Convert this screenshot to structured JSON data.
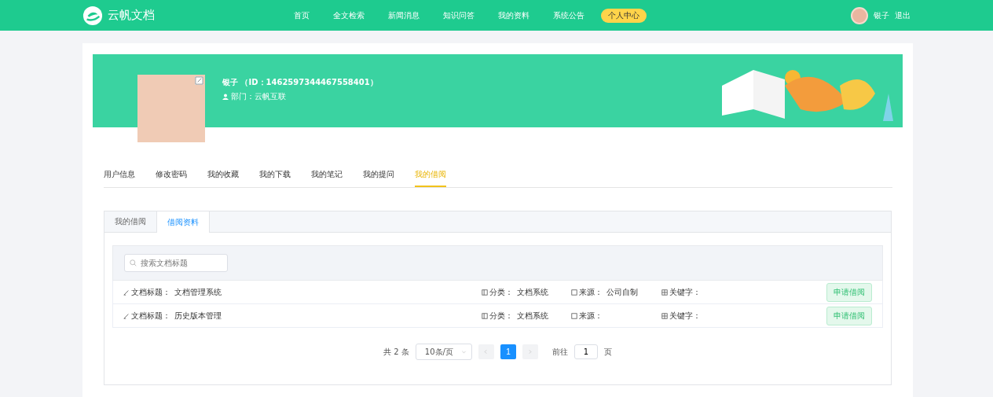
{
  "header": {
    "logo": "云帆文档",
    "nav": [
      {
        "label": "首页",
        "selected": false
      },
      {
        "label": "全文检索",
        "selected": false
      },
      {
        "label": "新闻消息",
        "selected": false
      },
      {
        "label": "知识问答",
        "selected": false
      },
      {
        "label": "我的资料",
        "selected": false
      },
      {
        "label": "系统公告",
        "selected": false
      },
      {
        "label": "个人中心",
        "selected": true
      }
    ],
    "user": "银子",
    "logout": "退出"
  },
  "profile": {
    "name": "银子 （ID：1462597344467558401）",
    "department": "部门：云帆互联"
  },
  "tabs": [
    {
      "label": "用户信息",
      "selected": false
    },
    {
      "label": "修改密码",
      "selected": false
    },
    {
      "label": "我的收藏",
      "selected": false
    },
    {
      "label": "我的下载",
      "selected": false
    },
    {
      "label": "我的笔记",
      "selected": false
    },
    {
      "label": "我的提问",
      "selected": false
    },
    {
      "label": "我的借阅",
      "selected": true
    }
  ],
  "subtabs": [
    {
      "label": "我的借阅",
      "selected": false
    },
    {
      "label": "借阅资料",
      "selected": true
    }
  ],
  "search": {
    "placeholder": "搜索文档标题"
  },
  "rows": [
    {
      "title_label": "文档标题：",
      "title": "文档管理系统",
      "category_label": "分类：",
      "category": "文档系统",
      "source_label": "来源：",
      "source": "公司自制",
      "keywords_label": "关键字：",
      "action": "申请借阅"
    },
    {
      "title_label": "文档标题：",
      "title": "历史版本管理",
      "category_label": "分类：",
      "category": "文档系统",
      "source_label": "来源：",
      "keywords_label": "关键字：",
      "action": "申请借阅"
    }
  ],
  "pagination": {
    "total": "共 2 条",
    "page_size": "10条/页",
    "pages": [
      {
        "label": "1",
        "selected": true
      }
    ],
    "goto_label": "前往",
    "goto_value": "1",
    "goto_suffix": "页"
  }
}
